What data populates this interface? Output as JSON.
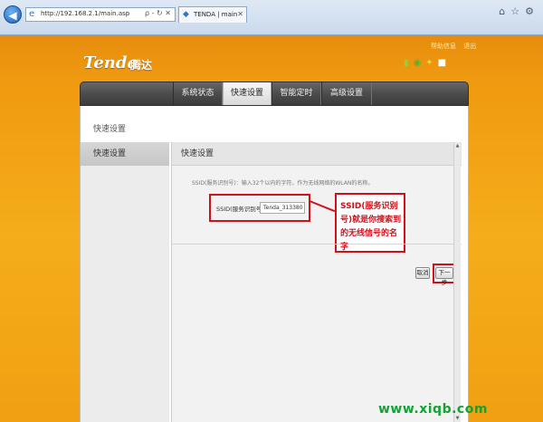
{
  "browser": {
    "back_icon": "back-arrow-icon",
    "forward_icon": "forward-arrow-icon",
    "url": "http://192.168.2.1/main.asp",
    "address_tools": "ρ - ↻ ✕",
    "tab_title": "TENDA | main",
    "window_icons": [
      "home-icon",
      "star-icon",
      "gear-icon"
    ]
  },
  "header": {
    "logo": "Tenda",
    "logo_cn": "腾达",
    "links": [
      "帮助信息",
      "退出"
    ],
    "status_icons": [
      "signal-icon",
      "globe-icon",
      "wps-icon",
      "power-icon"
    ]
  },
  "menu": {
    "items": [
      "系统状态",
      "快速设置",
      "智能定时",
      "高级设置"
    ],
    "active_index": 1
  },
  "breadcrumb": "快速设置",
  "sidebar": {
    "items": [
      "快速设置"
    ]
  },
  "content": {
    "title": "快速设置",
    "hint": "SSID(服务识别号)：输入32个以内的字符，作为无线网络的WLAN的名称。",
    "ssid_label": "SSID(服务识别号):",
    "ssid_value": "Tenda_313380",
    "callout": "SSID(服务识别号)就是你搜索到的无线信号的名字",
    "cancel_label": "取消",
    "next_label": "下一步"
  },
  "watermark": "www.xiqb.com",
  "colors": {
    "annotation_red": "#d2101a",
    "background_orange": "#f09a10",
    "menu_dark": "#4a4a4a"
  }
}
